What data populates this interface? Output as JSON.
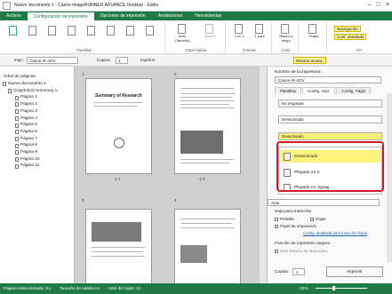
{
  "window": {
    "title": "Nuevo documento 1 - Canon imageRUNNER ADVANCE Desktop - Editor"
  },
  "ribbon_tabs": [
    "Archivo",
    "Configuración de impresión",
    "Opciones de impresión",
    "Anotaciones",
    "Herramientas"
  ],
  "ribbon": {
    "groups": [
      "Plantillas",
      "Papel salida",
      "Formato",
      "Color",
      "Ver"
    ],
    "papel": "Auto\n(Tamaño)",
    "vertical": "Vertical",
    "n1": "1 en 1",
    "cara": "1 cara",
    "color": "Blanco y negro",
    "grapa": "Grapa",
    "navegacion": "Navegación",
    "conf_detallada": "Conf. detallada"
  },
  "toolbar": {
    "impr_label": "Impr.:",
    "printer": "Canon iR-ADV",
    "copias_label": "Copias:",
    "copias": "1",
    "imprimir": "Imprimir",
    "zoom": "",
    "mostrar": "Mostrar anotac."
  },
  "left": {
    "title": "Árbol de páginas",
    "tree": [
      "Nuevo documento 1",
      "(Capítulo2) Summary o",
      "Página 1",
      "Página 2",
      "Página 3",
      "Página 4",
      "Página 5",
      "Página 6",
      "Página 7",
      "Página 8",
      "Página 9",
      "Página 10",
      "Página 11"
    ]
  },
  "canvas": {
    "thumbs": [
      {
        "num": "1",
        "label": "1-1"
      },
      {
        "num": "2",
        "label": "1-2"
      },
      {
        "num": "3",
        "label": ""
      },
      {
        "num": "4",
        "label": ""
      }
    ],
    "doc_title": "Summary of Research"
  },
  "right": {
    "printer_label": "Nombre de la impresora:",
    "printer": "Canon iR-ADV",
    "tabs": [
      "Plantillas",
      "Config. impr.",
      "Config. Págin"
    ],
    "top_opt": "No engrapar",
    "desactivado1": "Desactivado",
    "desactivado2": "Desactivado",
    "dropdown": [
      "Desactivado",
      "Plegado en C",
      "Plegado en zigzag"
    ],
    "auto": "Auto",
    "hoja_title": "Hoja para inserción",
    "portada": "Portada",
    "hojas": "Hojas",
    "papel_sep": "Papel de separación",
    "config_link": "Config. detallada para inserción hojas",
    "segura": "Función de impresión segura",
    "usar_funcion": "Usar función de dispositivo",
    "copias_label": "Copias:",
    "copias": "1",
    "imprimir": "Imprimir"
  },
  "status": {
    "seleccionada": "Página seleccionada: /11",
    "tamano": "Tamaño de salida:A4",
    "total": "total de hojas: 11",
    "zoom": "25%"
  },
  "colors": {
    "accent": "#1f7a46",
    "highlight": "#fff27a",
    "redbox": "#d11b2a"
  }
}
